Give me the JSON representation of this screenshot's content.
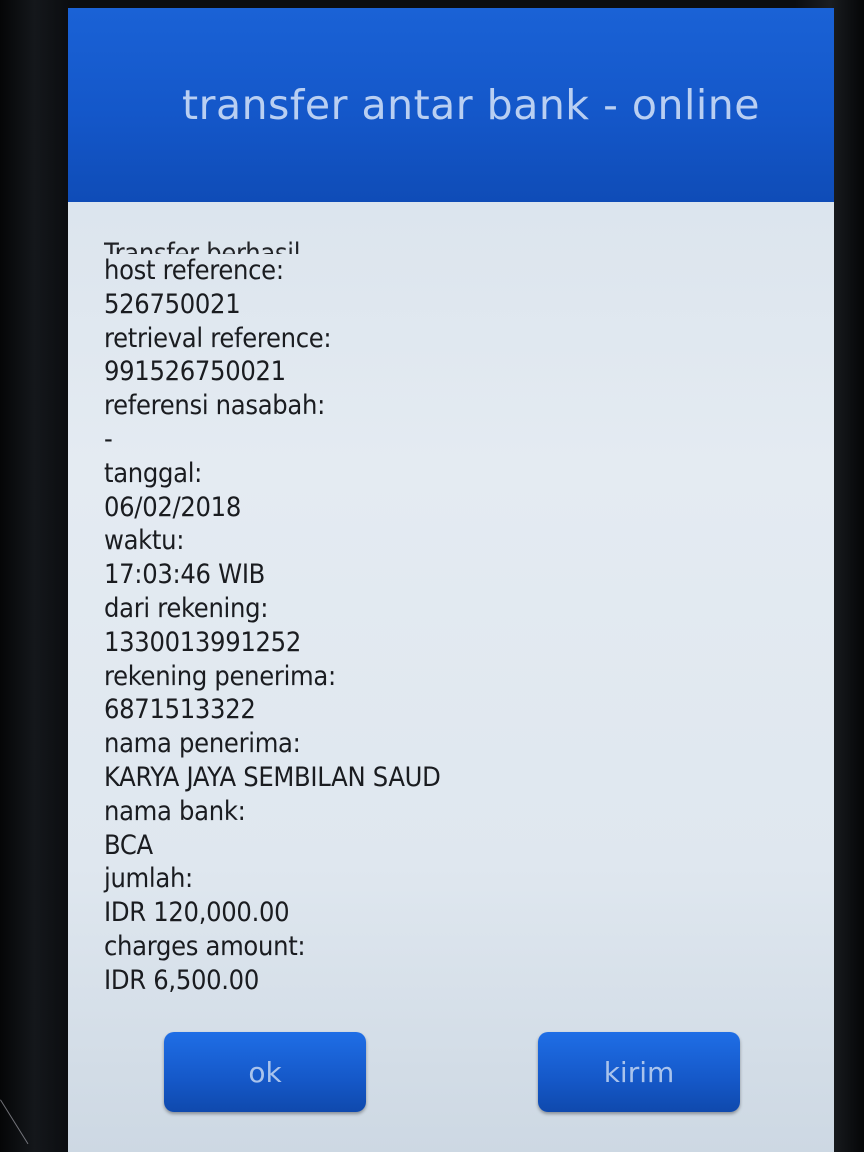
{
  "header": {
    "title": "transfer antar bank - online"
  },
  "details": {
    "status": "Transfer berhasil",
    "lines": [
      "host reference:",
      "526750021",
      "retrieval reference:",
      "991526750021",
      "referensi nasabah:",
      "-",
      "tanggal:",
      "06/02/2018",
      "waktu:",
      "17:03:46 WIB",
      "dari rekening:",
      "1330013991252",
      "rekening penerima:",
      "6871513322",
      "nama penerima:",
      "KARYA JAYA SEMBILAN SAUD",
      "nama bank:",
      "BCA",
      "jumlah:",
      "IDR 120,000.00",
      "charges amount:",
      "IDR 6,500.00"
    ]
  },
  "buttons": {
    "ok_label": "ok",
    "kirim_label": "kirim"
  },
  "colors": {
    "header_blue": "#1457c9",
    "button_blue": "#1558c8",
    "screen_bg": "#e4ebf2"
  }
}
